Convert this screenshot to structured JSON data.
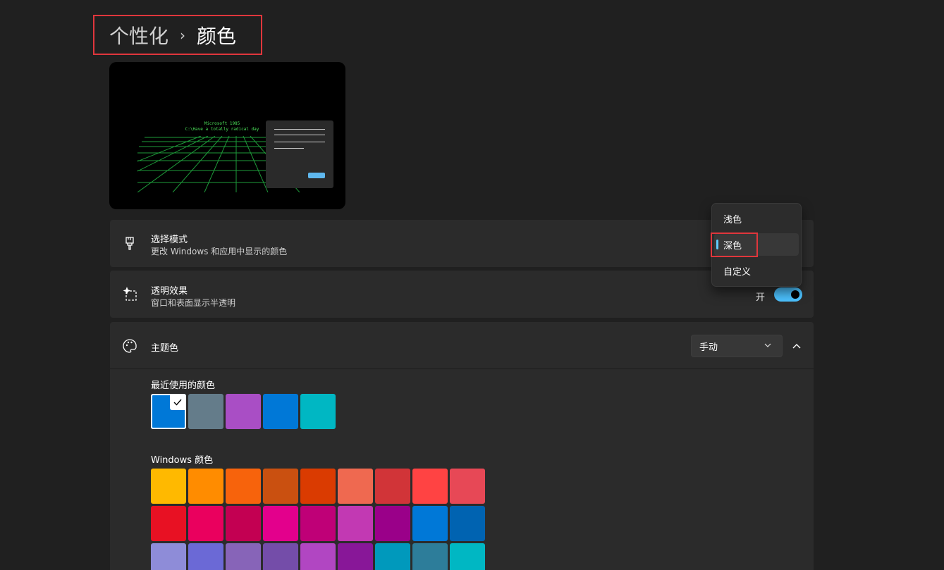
{
  "breadcrumb": {
    "parent": "个性化",
    "separator": "›",
    "current": "颜色"
  },
  "preview": {
    "console_line1": "Microsoft 1985",
    "console_line2": "C:\\Have a totally radical day"
  },
  "mode": {
    "title": "选择模式",
    "subtitle": "更改 Windows 和应用中显示的颜色",
    "menu": [
      {
        "label": "浅色",
        "selected": false
      },
      {
        "label": "深色",
        "selected": true
      },
      {
        "label": "自定义",
        "selected": false
      }
    ]
  },
  "transparency": {
    "title": "透明效果",
    "subtitle": "窗口和表面显示半透明",
    "state_label": "开",
    "on": true
  },
  "accent": {
    "title": "主题色",
    "dropdown_value": "手动"
  },
  "recent": {
    "title": "最近使用的颜色",
    "colors": [
      "#0078d7",
      "#647c8a",
      "#a94ec5",
      "#0078d7",
      "#00b7c3"
    ],
    "selected_index": 0
  },
  "windows_colors": {
    "title": "Windows 颜色",
    "rows": [
      [
        "#ffb900",
        "#ff8c00",
        "#f7630c",
        "#ca5010",
        "#da3b01",
        "#ef6950",
        "#d13438",
        "#ff4343",
        "#e74856"
      ],
      [
        "#e81123",
        "#ea005e",
        "#c30052",
        "#e3008c",
        "#bf0077",
        "#c239b3",
        "#9a0089",
        "#0078d7",
        "#0063b1"
      ],
      [
        "#8e8cd8",
        "#6b69d6",
        "#8764b8",
        "#744da9",
        "#b146c2",
        "#881798",
        "#0099bc",
        "#2d7d9a",
        "#00b7c3"
      ]
    ]
  },
  "colors": {
    "accent": "#60cdff",
    "toggle_on": "#4cc2ff",
    "highlight": "#e0363c",
    "card": "#2b2b2b",
    "background": "#202020"
  }
}
